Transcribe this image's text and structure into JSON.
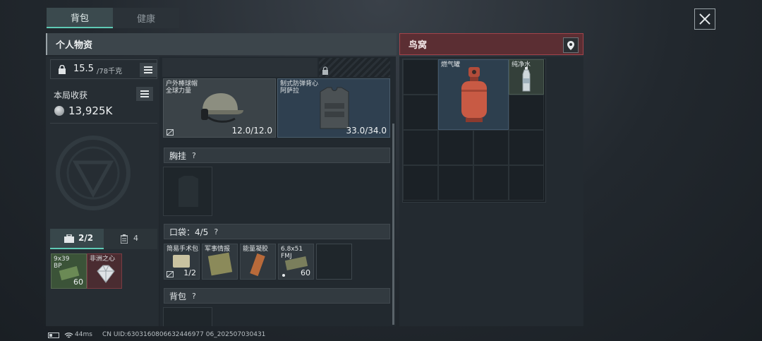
{
  "tabs": [
    {
      "label": "背包"
    },
    {
      "label": "健康"
    }
  ],
  "left_header": {
    "title": "个人物资"
  },
  "right_header": {
    "title": "鸟窝"
  },
  "weight": {
    "current": "15.5",
    "max": "/78千克"
  },
  "harvest": {
    "label": "本局收获",
    "value": "13,925K"
  },
  "counters": {
    "case": "2/2",
    "pouch": "4"
  },
  "case_items": [
    {
      "name": "9x39 BP",
      "count": "60"
    },
    {
      "name": "非洲之心"
    }
  ],
  "equipment": [
    {
      "name_line1": "户外棒球帽",
      "name_line2": "全球力量",
      "durability": "12.0/12.0"
    },
    {
      "name_line1": "制式防弹背心",
      "name_line2": "阿萨拉",
      "durability": "33.0/34.0"
    }
  ],
  "sections": {
    "chest_rig": "胸挂",
    "pockets": "口袋：4/5",
    "backpack": "背包",
    "help": "?"
  },
  "pocket_items": [
    {
      "name": "简易手术包",
      "count": "1/2"
    },
    {
      "name": "军事情报",
      "count": ""
    },
    {
      "name": "能量凝胶",
      "count": ""
    },
    {
      "name": "6.8x51 FMJ",
      "count": "60"
    }
  ],
  "stash_items": [
    {
      "name": "燃气罐"
    },
    {
      "name": "纯净水"
    }
  ],
  "status_bar": {
    "ping": "44ms",
    "uid": "CN UID:6303160806632446977 06_202507030431"
  },
  "colors": {
    "accent": "#5fcab5",
    "danger": "#8a3a3f"
  }
}
